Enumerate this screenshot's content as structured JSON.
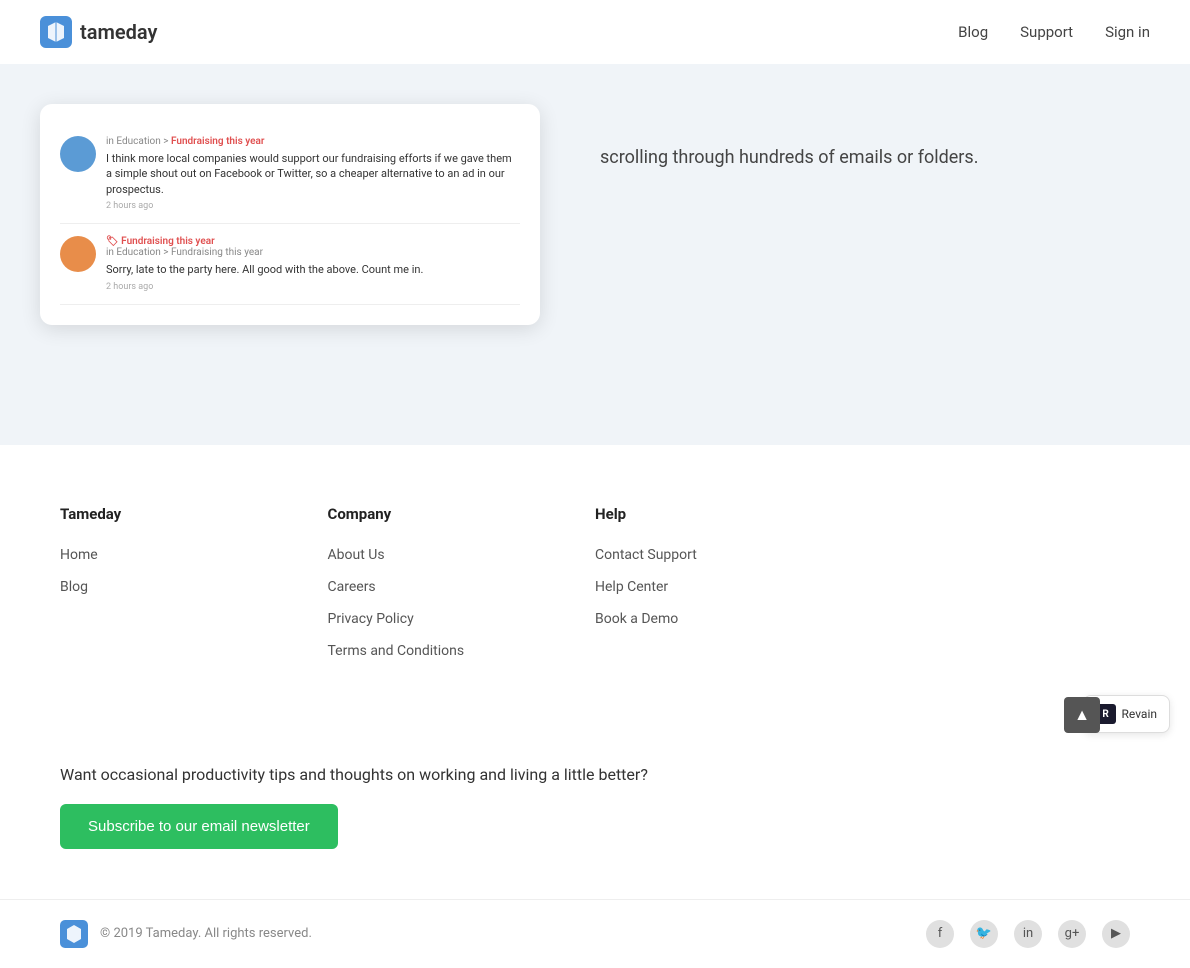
{
  "navbar": {
    "logo_text": "tameday",
    "links": [
      {
        "label": "Blog",
        "id": "blog"
      },
      {
        "label": "Support",
        "id": "support"
      },
      {
        "label": "Sign in",
        "id": "signin"
      }
    ]
  },
  "hero": {
    "description_text": "scrolling through hundreds of emails or folders."
  },
  "mock_posts": [
    {
      "tag": "in Education > Fundraising this year",
      "text": "I think more local companies would support our fundraising efforts if we gave them a simple shout out on Facebook or Twitter, so a cheaper alternative to an ad in our prospectus.",
      "time": "2 hours ago",
      "avatar_color": "blue"
    },
    {
      "tag": "in Education > Fundraising this year",
      "title": "Fundraising this year",
      "sub_tag": "in Education > Fundraising this year",
      "text": "Sorry, late to the party here. All good with the above. Count me in.",
      "time": "2 hours ago",
      "avatar_color": "orange"
    }
  ],
  "footer": {
    "columns": [
      {
        "id": "tameday",
        "title": "Tameday",
        "links": [
          {
            "label": "Home",
            "id": "home"
          },
          {
            "label": "Blog",
            "id": "blog"
          }
        ]
      },
      {
        "id": "company",
        "title": "Company",
        "links": [
          {
            "label": "About Us",
            "id": "about-us"
          },
          {
            "label": "Careers",
            "id": "careers"
          },
          {
            "label": "Privacy Policy",
            "id": "privacy-policy"
          },
          {
            "label": "Terms and Conditions",
            "id": "terms"
          }
        ]
      },
      {
        "id": "help",
        "title": "Help",
        "links": [
          {
            "label": "Contact Support",
            "id": "contact-support"
          },
          {
            "label": "Help Center",
            "id": "help-center"
          },
          {
            "label": "Book a Demo",
            "id": "book-demo"
          }
        ]
      }
    ],
    "newsletter": {
      "tagline": "Want occasional productivity tips and thoughts on working and living a little better?",
      "button_label": "Subscribe to our email newsletter"
    },
    "bottom": {
      "copyright": "© 2019 Tameday. All rights reserved.",
      "social": [
        {
          "label": "Facebook",
          "icon": "f"
        },
        {
          "label": "Twitter",
          "icon": "t"
        },
        {
          "label": "LinkedIn",
          "icon": "in"
        },
        {
          "label": "Google+",
          "icon": "g+"
        },
        {
          "label": "YouTube",
          "icon": "▶"
        }
      ]
    }
  },
  "revain": {
    "label": "Revain"
  }
}
